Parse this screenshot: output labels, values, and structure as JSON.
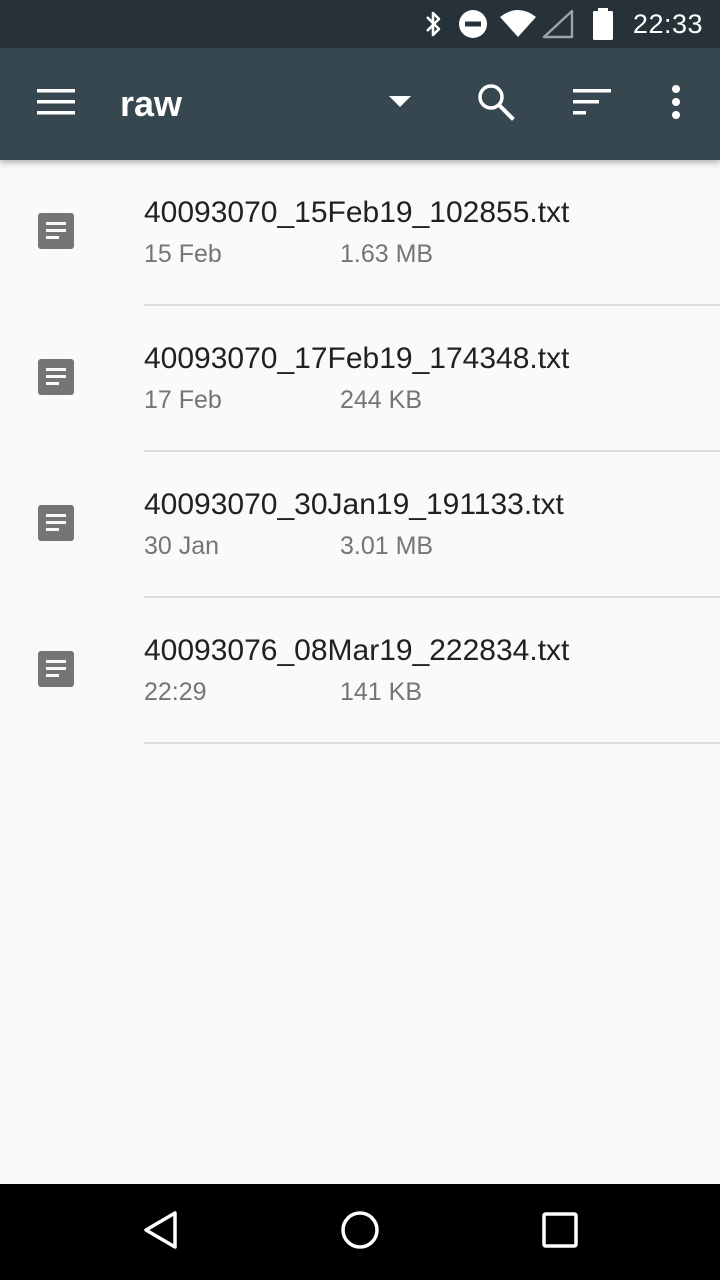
{
  "status_bar": {
    "time": "22:33",
    "icons": [
      "bluetooth-icon",
      "do-not-disturb-icon",
      "wifi-icon",
      "cell-signal-icon",
      "battery-icon"
    ]
  },
  "toolbar": {
    "title": "raw",
    "icons": [
      "menu-icon",
      "dropdown-arrow-icon",
      "search-icon",
      "sort-icon",
      "more-vert-icon"
    ]
  },
  "files": [
    {
      "name": "40093070_15Feb19_102855.txt",
      "date": "15 Feb",
      "size": "1.63 MB",
      "icon": "document-icon"
    },
    {
      "name": "40093070_17Feb19_174348.txt",
      "date": "17 Feb",
      "size": "244 KB",
      "icon": "document-icon"
    },
    {
      "name": "40093070_30Jan19_191133.txt",
      "date": "30 Jan",
      "size": "3.01 MB",
      "icon": "document-icon"
    },
    {
      "name": "40093076_08Mar19_222834.txt",
      "date": "22:29",
      "size": "141 KB",
      "icon": "document-icon"
    }
  ],
  "nav_bar": {
    "icons": [
      "back-icon",
      "home-icon",
      "recents-icon"
    ]
  },
  "colors": {
    "status_bar": "#263238",
    "toolbar": "#37474f",
    "background": "#fafafa",
    "icon_gray": "#757575"
  }
}
